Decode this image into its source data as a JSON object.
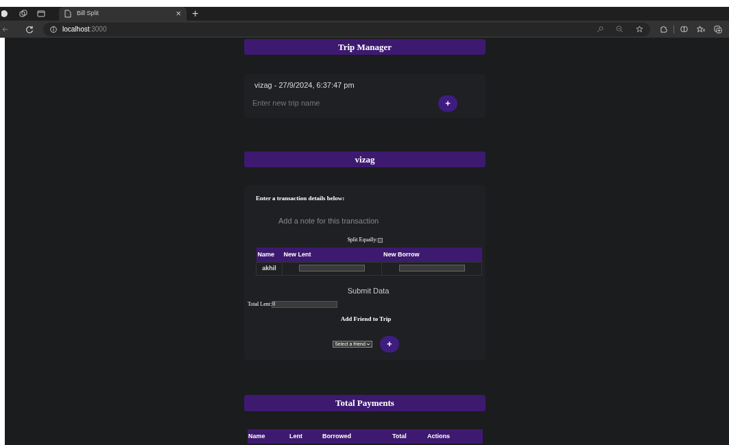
{
  "browser": {
    "tab_title": "Bill Split",
    "tab_close": "×",
    "new_tab": "+",
    "url_host": "localhost",
    "url_port": ":3000"
  },
  "trip_manager": {
    "title": "Trip Manager",
    "trips": [
      {
        "label": "vizag - 27/9/2024, 6:37:47 pm"
      }
    ],
    "new_trip": {
      "placeholder": "Enter new trip name"
    },
    "add_button": "+"
  },
  "trip": {
    "title": "vizag",
    "prompt": "Enter a transaction details below:",
    "note": {
      "placeholder": "Add a note for this transaction"
    },
    "split_equally": {
      "label": "Split Equally:",
      "checked": false
    },
    "table": {
      "columns": [
        "Name",
        "New Lent",
        "New Borrow"
      ],
      "rows": [
        {
          "name": "akhil"
        }
      ]
    },
    "submit": "Submit Data",
    "total_lent": {
      "label": "Total Lent:",
      "value": "0"
    },
    "add_friend_title": "Add Friend to Trip",
    "friend_select": "Select a friend",
    "add_button": "+"
  },
  "total_payments": {
    "title": "Total Payments",
    "columns": [
      "Name",
      "Lent",
      "Borrowed",
      "Total",
      "Actions"
    ]
  }
}
